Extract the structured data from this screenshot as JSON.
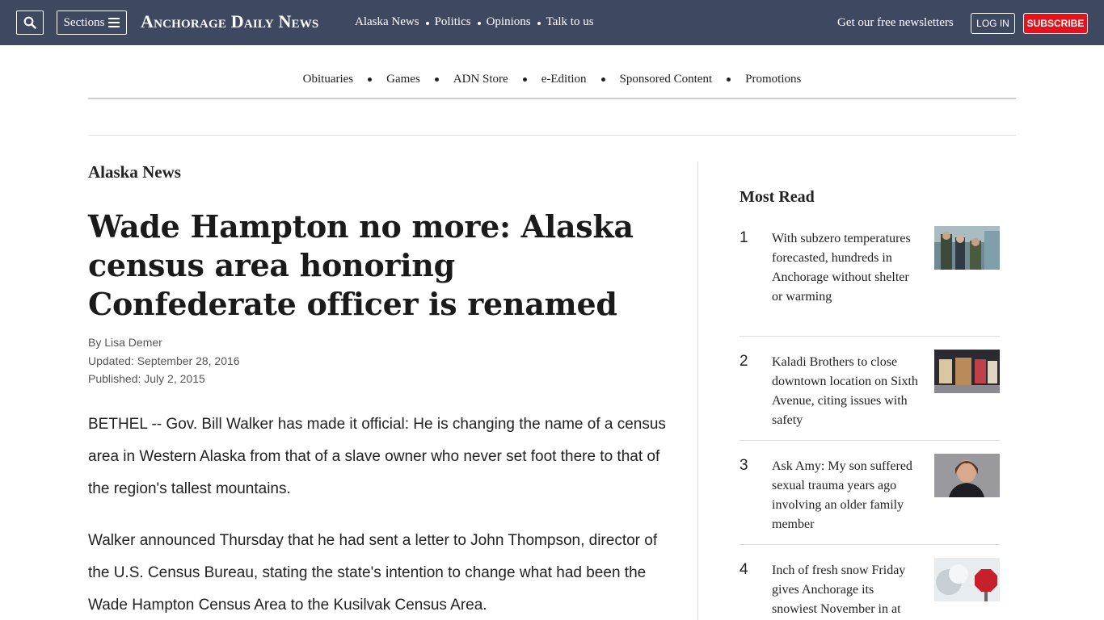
{
  "header": {
    "logo": "Anchorage Daily News",
    "sections_label": "Sections",
    "nav": [
      "Alaska News",
      "Politics",
      "Opinions",
      "Talk to us"
    ],
    "newsletter": "Get our free newsletters",
    "login": "LOG IN",
    "subscribe": "SUBSCRIBE"
  },
  "subnav": [
    "Obituaries",
    "Games",
    "ADN Store",
    "e-Edition",
    "Sponsored Content",
    "Promotions"
  ],
  "article": {
    "section": "Alaska News",
    "headline": "Wade Hampton no more: Alaska census area honoring Confederate officer is renamed",
    "byline": "By Lisa Demer",
    "updated": "Updated: September 28, 2016",
    "published": "Published: July 2, 2015",
    "paragraphs": [
      "BETHEL -- Gov. Bill Walker has made it official: He is changing the name of a census area in Western Alaska from that of a slave owner who never set foot there to that of the region's tallest mountains.",
      "Walker announced Thursday that he had sent a letter to John Thompson, director of the U.S. Census Bureau, stating the state's intention to change what had been the Wade Hampton Census Area to the Kusilvak Census Area."
    ]
  },
  "most_read": {
    "title": "Most Read",
    "items": [
      {
        "num": "1",
        "text": "With subzero temperatures forecasted, hundreds in Anchorage without shelter or warming"
      },
      {
        "num": "2",
        "text": "Kaladi Brothers to close downtown location on Sixth Avenue, citing issues with safety"
      },
      {
        "num": "3",
        "text": "Ask Amy: My son suffered sexual trauma years ago involving an older family member"
      },
      {
        "num": "4",
        "text": "Inch of fresh snow Friday gives Anchorage its snowiest November in at"
      }
    ]
  },
  "colors": {
    "header_bg": "#3f4861",
    "subscribe_bg": "#e5121c"
  }
}
